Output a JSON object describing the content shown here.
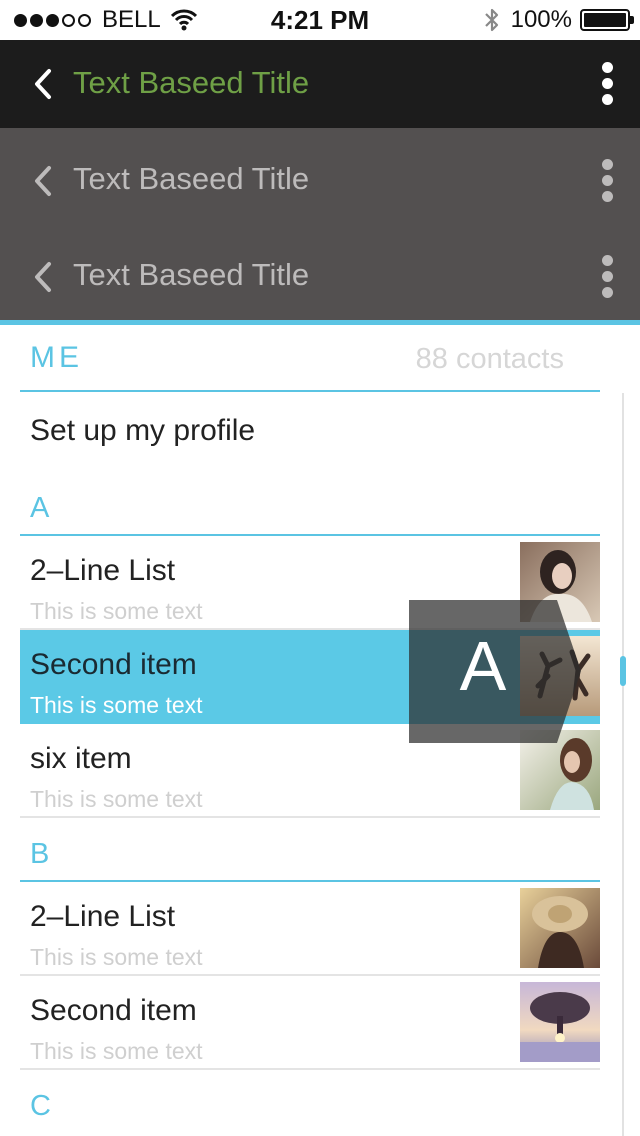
{
  "status_bar": {
    "carrier": "BELL",
    "time": "4:21 PM",
    "battery_percent": "100%",
    "signal_dots_filled": 3,
    "signal_dots_total": 5
  },
  "navbars": [
    {
      "title": "Text Baseed Title",
      "style": "dark"
    },
    {
      "title": "Text Baseed Title",
      "style": "gray"
    },
    {
      "title": "Text Baseed Title",
      "style": "gray"
    }
  ],
  "contacts": {
    "me_label": "ME",
    "count_label": "88 contacts",
    "profile_label": "Set up my profile",
    "sections": [
      {
        "letter": "A",
        "items": [
          {
            "title": "2–Line List",
            "subtitle": "This is some text",
            "selected": false,
            "thumb": "woman-headphones-photo"
          },
          {
            "title": "Second item",
            "subtitle": "This is some text",
            "selected": true,
            "thumb": "jumping-people-photo"
          },
          {
            "title": "six item",
            "subtitle": "This is some text",
            "selected": false,
            "thumb": "woman-outdoors-photo"
          }
        ]
      },
      {
        "letter": "B",
        "items": [
          {
            "title": "2–Line List",
            "subtitle": "This is some text",
            "selected": false,
            "thumb": "woman-hat-photo"
          },
          {
            "title": "Second item",
            "subtitle": "This is some text",
            "selected": false,
            "thumb": "tree-sunset-photo"
          }
        ]
      },
      {
        "letter": "C",
        "items": []
      }
    ],
    "fast_scroll_letter": "A"
  },
  "colors": {
    "accent": "#5bc4e3",
    "title_green": "#6fa046",
    "dark_bar": "#1c1c1c",
    "gray_bar": "#535050",
    "selected_row": "#5bc9e6"
  }
}
